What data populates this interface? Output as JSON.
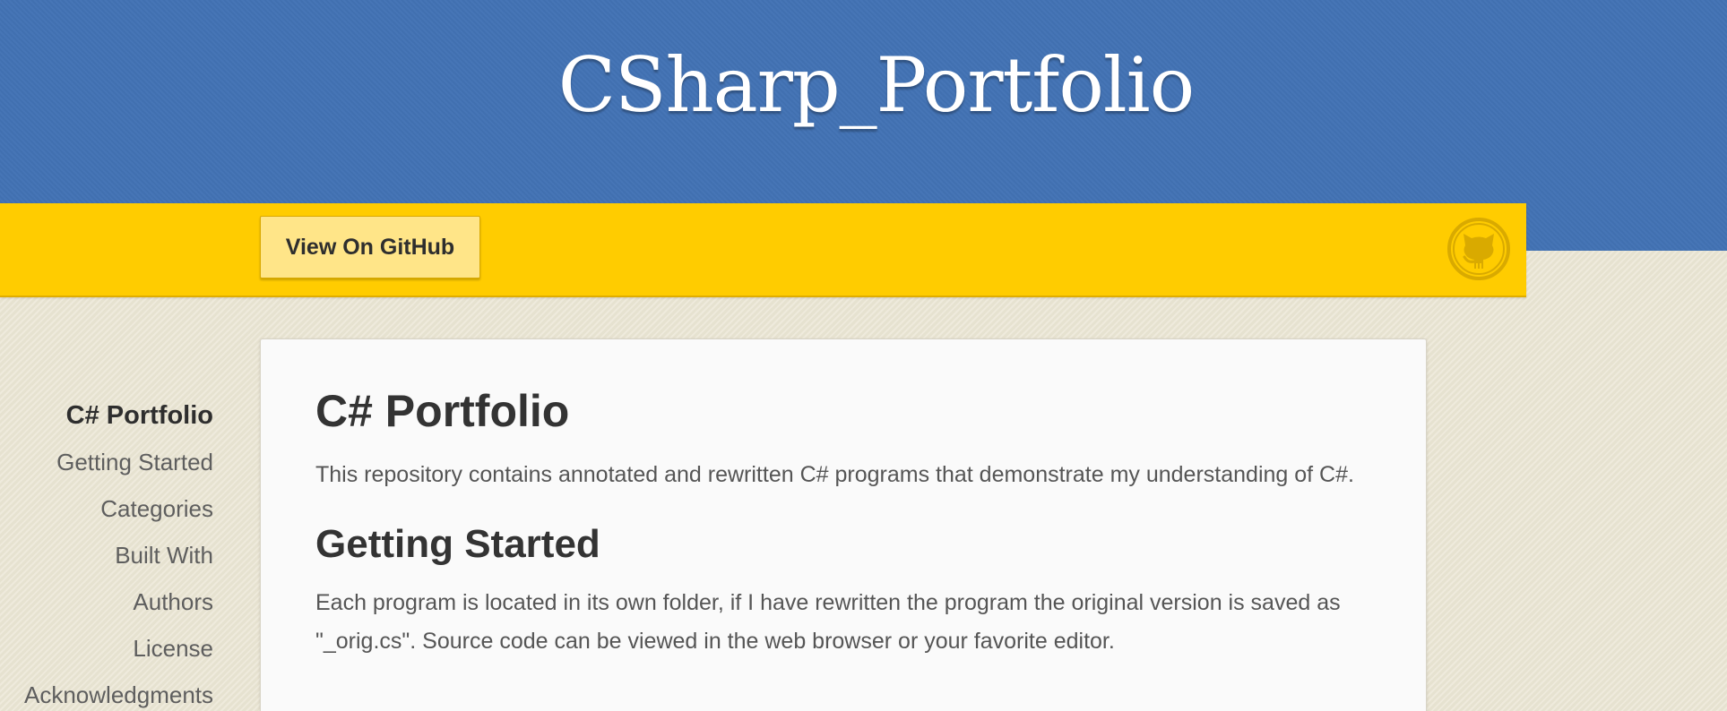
{
  "header": {
    "site_title": "CSharp_Portfolio",
    "view_button": "View On GitHub",
    "github_icon": "github-octocat-icon"
  },
  "sidebar": {
    "items": [
      {
        "label": "C# Portfolio",
        "current": true
      },
      {
        "label": "Getting Started"
      },
      {
        "label": "Categories"
      },
      {
        "label": "Built With"
      },
      {
        "label": "Authors"
      },
      {
        "label": "License"
      },
      {
        "label": "Acknowledgments"
      }
    ]
  },
  "content": {
    "heading": "C# Portfolio",
    "intro": "This repository contains annotated and rewritten C# programs that demonstrate my understanding of C#.",
    "section_heading": "Getting Started",
    "section_text": "Each program is located in its own folder, if I have rewritten the program the original version is saved as \"_orig.cs\". Source code can be viewed in the web browser or your favorite editor."
  },
  "colors": {
    "header_blue": "#4272b4",
    "bar_yellow": "#ffcc00",
    "button_yellow": "#ffe588",
    "background_beige": "#ebe6d4",
    "card_white": "#fafafa",
    "text_dark": "#333333"
  }
}
